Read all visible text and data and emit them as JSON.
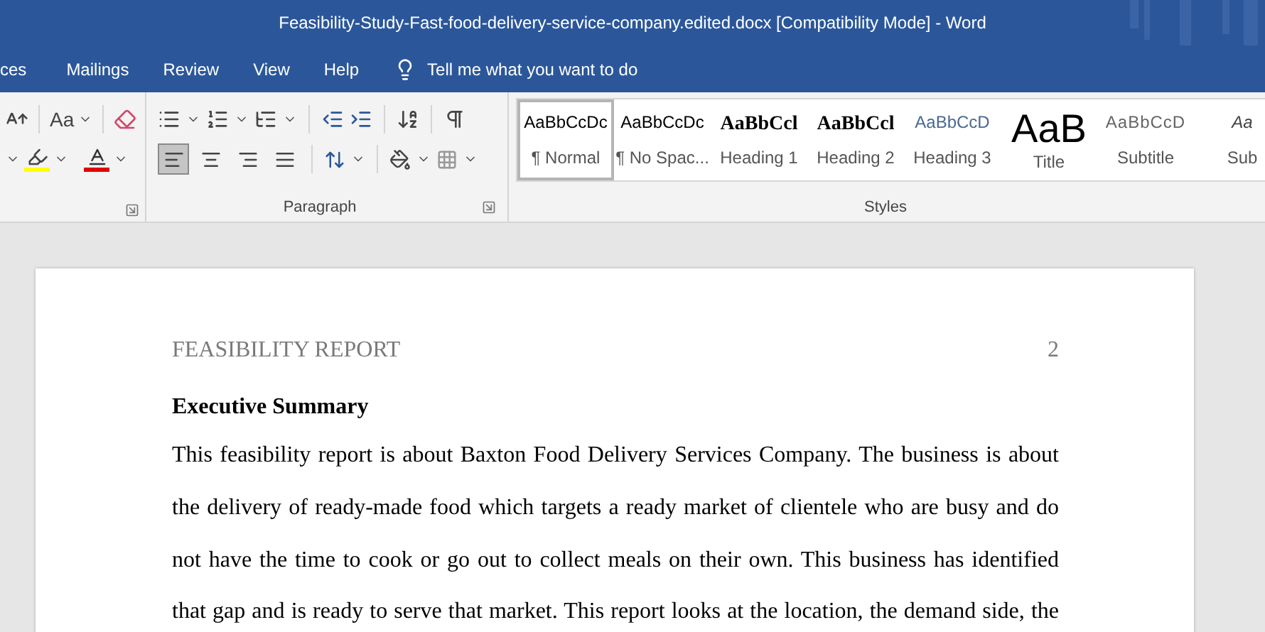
{
  "window": {
    "title": "Feasibility-Study-Fast-food-delivery-service-company.edited.docx [Compatibility Mode]  -  Word"
  },
  "tabs": [
    {
      "label": "ces",
      "selected": false
    },
    {
      "label": "Mailings",
      "selected": false
    },
    {
      "label": "Review",
      "selected": false
    },
    {
      "label": "View",
      "selected": false
    },
    {
      "label": "Help",
      "selected": false
    }
  ],
  "tell_me": {
    "placeholder": "Tell me what you want to do"
  },
  "font_group": {
    "change_case": "Aa"
  },
  "paragraph_group": {
    "label": "Paragraph",
    "alignments": [
      {
        "kind": "left",
        "selected": true
      },
      {
        "kind": "center",
        "selected": false
      },
      {
        "kind": "right",
        "selected": false
      },
      {
        "kind": "justify",
        "selected": false
      }
    ]
  },
  "styles_group": {
    "label": "Styles",
    "items": [
      {
        "kind": "normal",
        "preview": "AaBbCcDc",
        "name": "¶ Normal",
        "selected": true
      },
      {
        "kind": "normal",
        "preview": "AaBbCcDc",
        "name": "¶ No Spac...",
        "selected": false
      },
      {
        "kind": "heading1",
        "preview": "AaBbCcl",
        "name": "Heading 1",
        "selected": false
      },
      {
        "kind": "heading2",
        "preview": "AaBbCcl",
        "name": "Heading 2",
        "selected": false
      },
      {
        "kind": "heading3",
        "preview": "AaBbCcD",
        "name": "Heading 3",
        "selected": false
      },
      {
        "kind": "title",
        "preview": "AaB",
        "name": "Title",
        "selected": false
      },
      {
        "kind": "subtitle",
        "preview": "AaBbCcD",
        "name": "Subtitle",
        "selected": false
      },
      {
        "kind": "subtle",
        "preview": "Aa",
        "name": "Sub",
        "selected": false
      }
    ]
  },
  "document": {
    "header": "FEASIBILITY REPORT",
    "page_number": "2",
    "heading": "Executive Summary",
    "paragraph": "This feasibility report is about Baxton Food Delivery Services Company. The business is about the delivery of ready-made food which targets a ready market of clientele who are busy and do not have the time to cook or go out to collect meals on their own. This business has identified that gap and is ready to serve that market. This report looks at the location, the demand side, the"
  }
}
